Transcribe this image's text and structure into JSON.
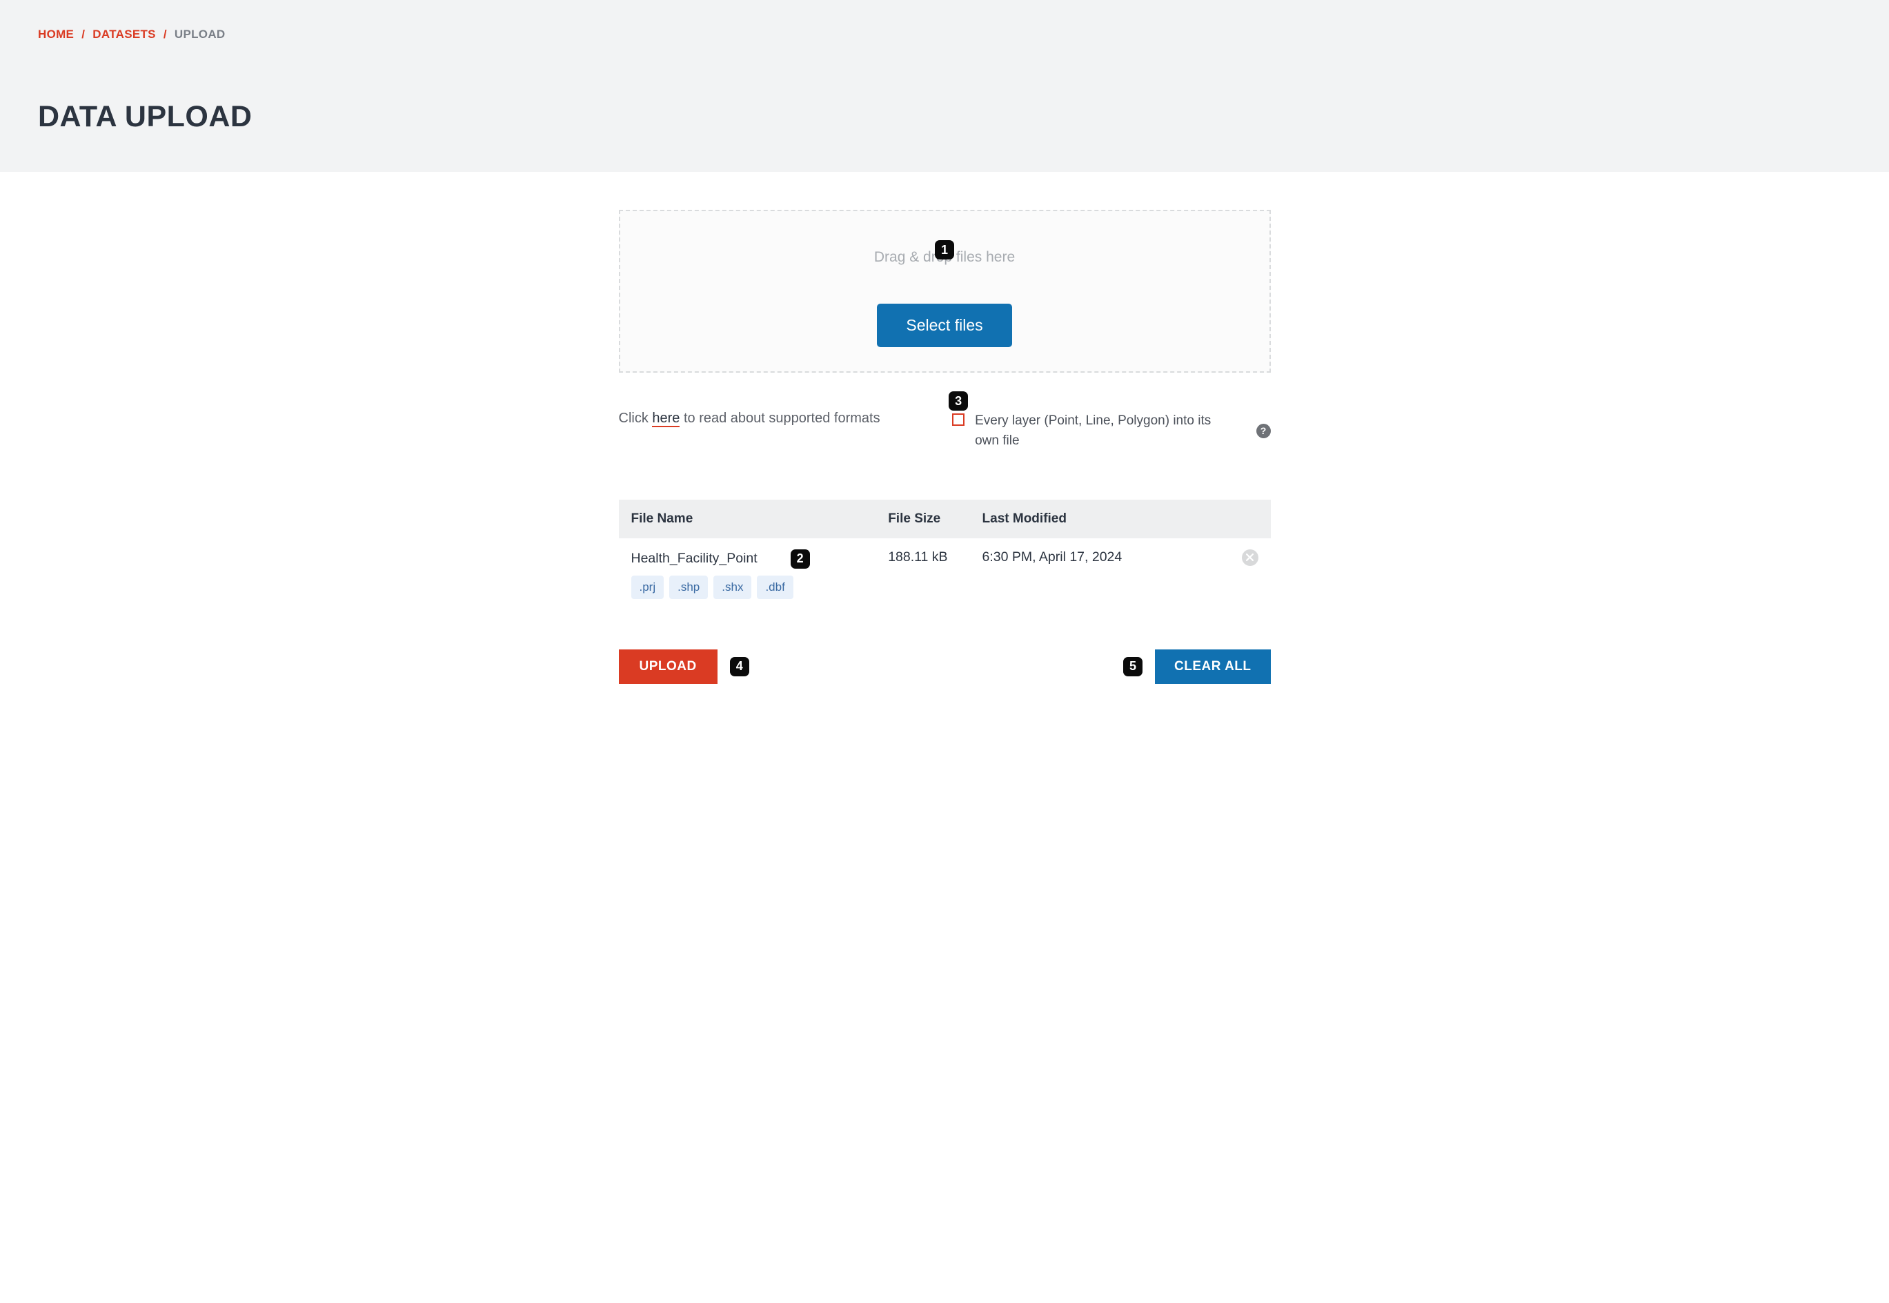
{
  "breadcrumb": {
    "home": "HOME",
    "datasets": "DATASETS",
    "current": "UPLOAD"
  },
  "page_title": "DATA UPLOAD",
  "annotation_badges": {
    "n1": "1",
    "n2": "2",
    "n3": "3",
    "n4": "4",
    "n5": "5"
  },
  "dropzone": {
    "text": "Drag & drop files here",
    "button": "Select files"
  },
  "supported_formats": {
    "prefix": "Click ",
    "link": "here",
    "suffix": " to read about supported formats"
  },
  "layer_option": {
    "label": "Every layer (Point, Line, Polygon) into its own file",
    "help": "?"
  },
  "table": {
    "headers": {
      "name": "File Name",
      "size": "File Size",
      "modified": "Last Modified"
    },
    "rows": [
      {
        "name": "Health_Facility_Point",
        "exts": [
          ".prj",
          ".shp",
          ".shx",
          ".dbf"
        ],
        "size": "188.11 kB",
        "modified": "6:30 PM, April 17, 2024"
      }
    ]
  },
  "actions": {
    "upload": "UPLOAD",
    "clear_all": "CLEAR ALL"
  }
}
